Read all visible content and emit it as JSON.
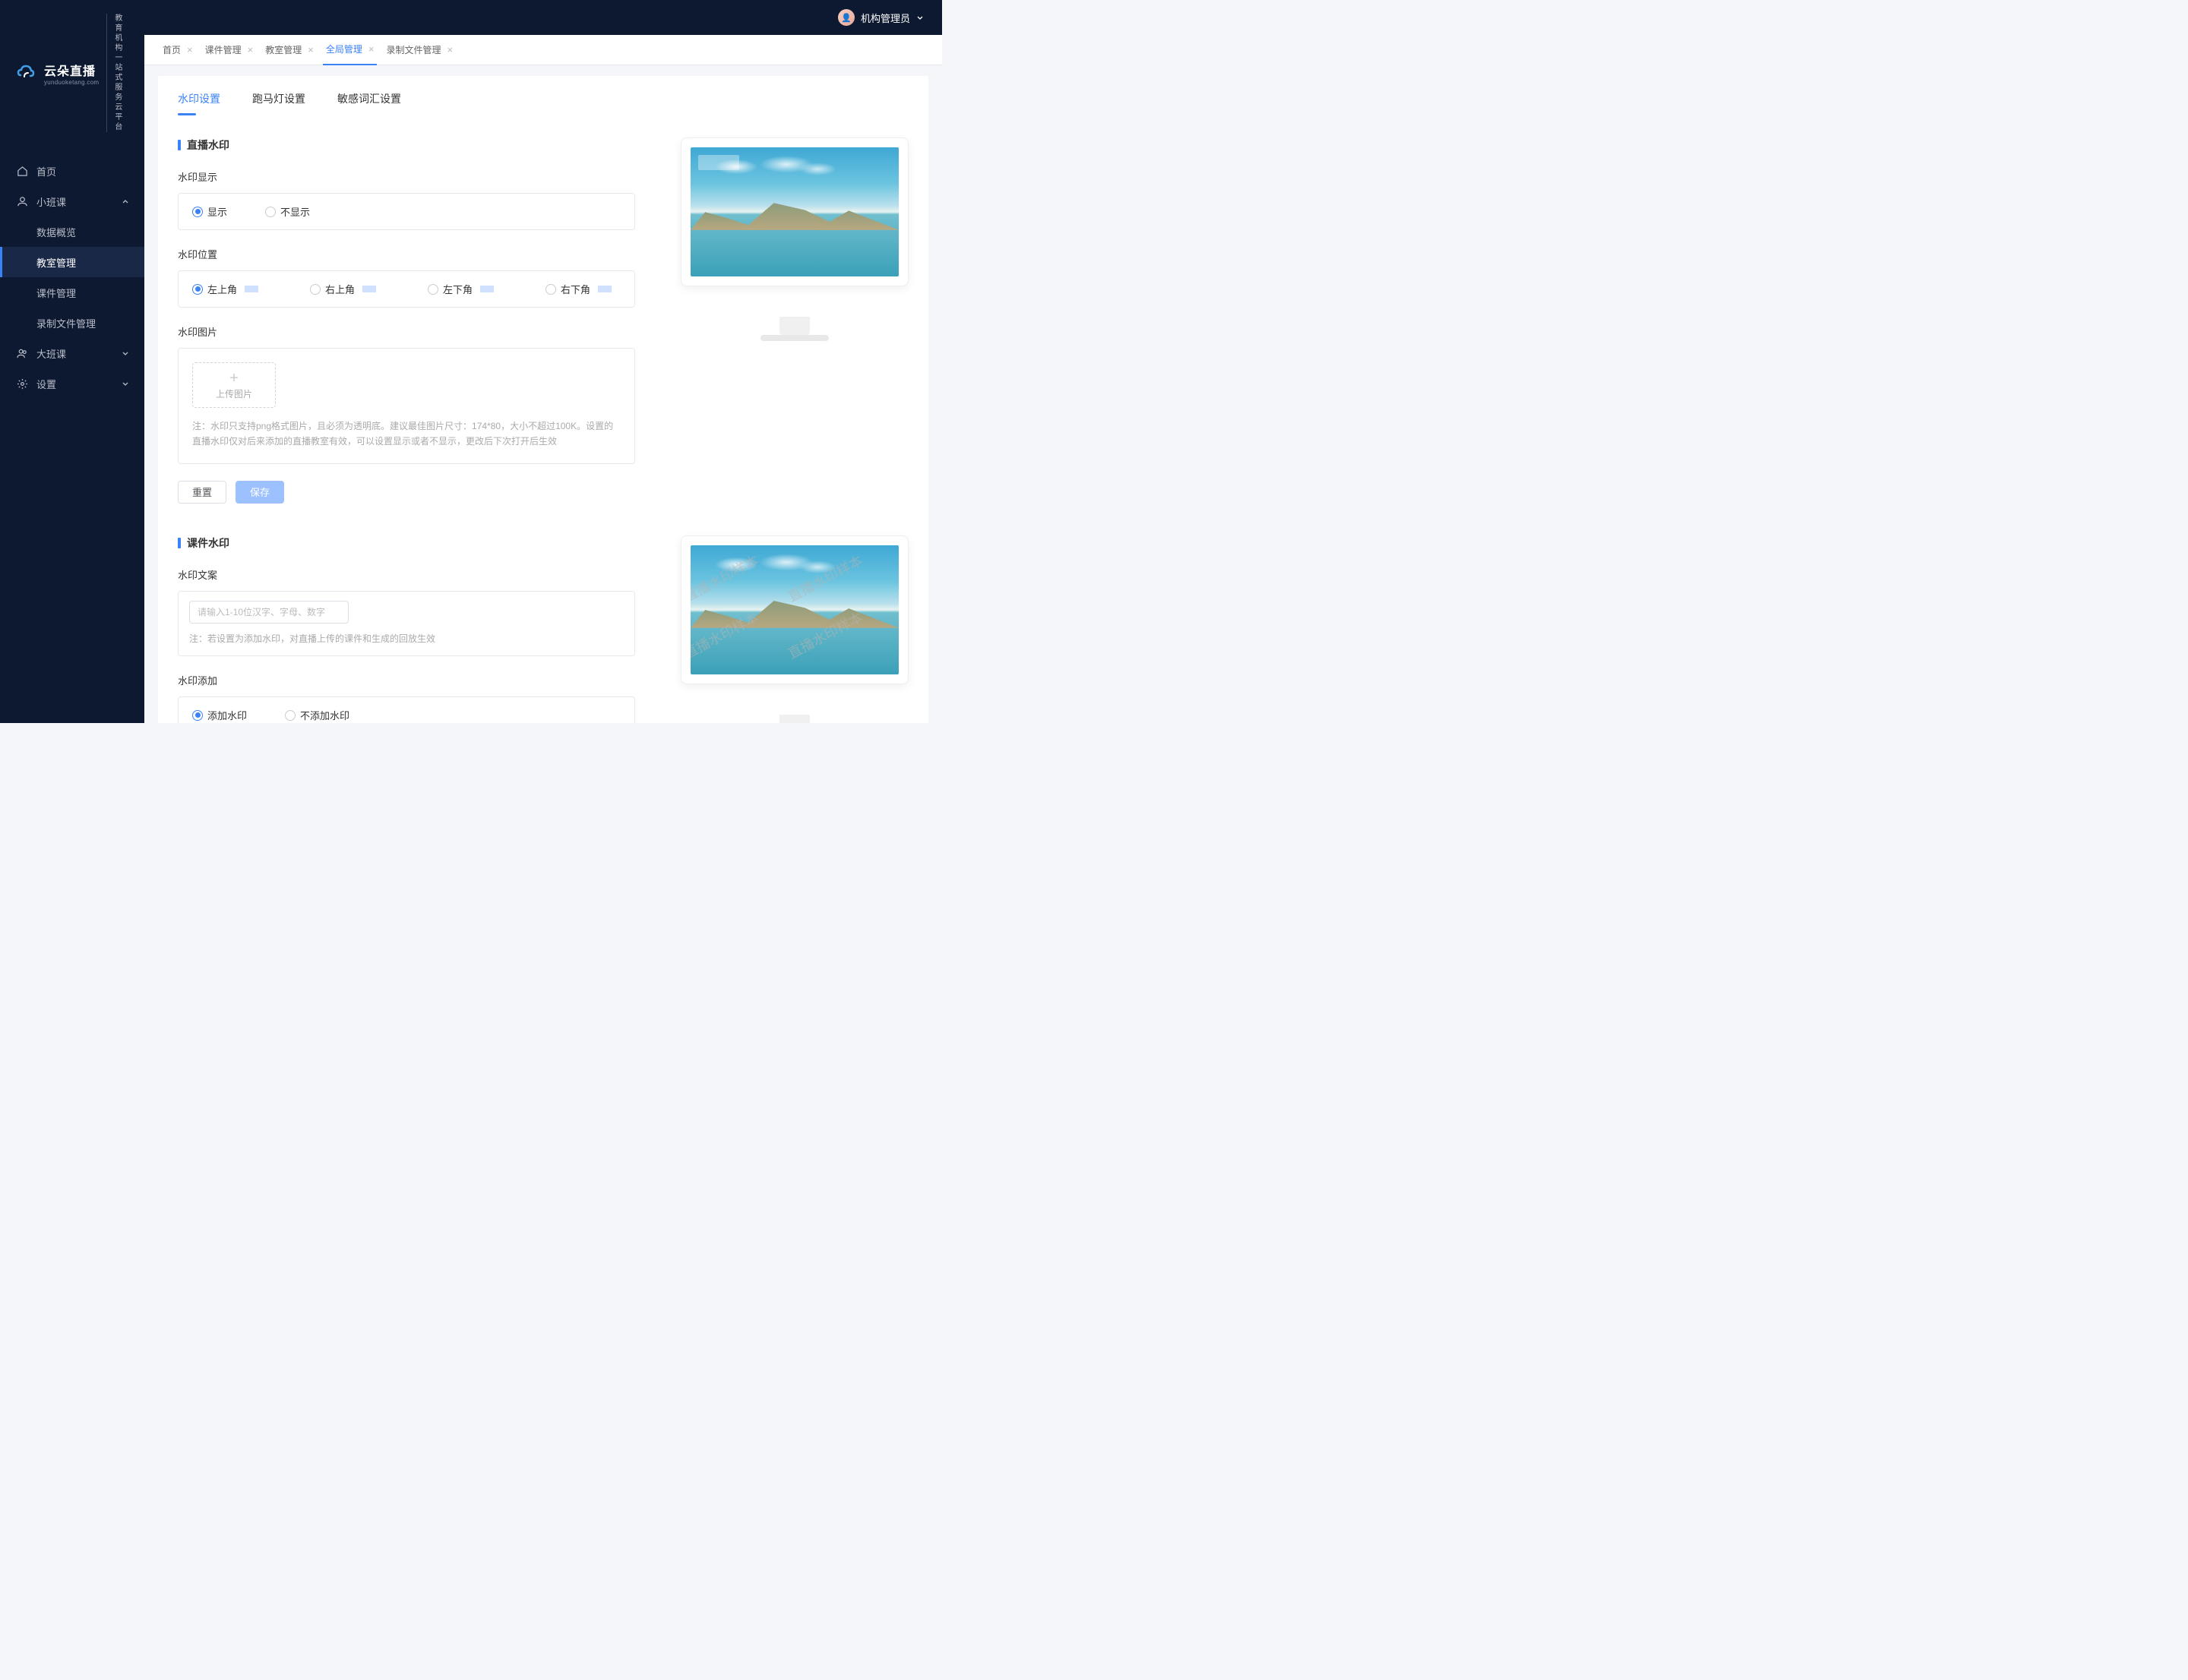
{
  "brand": {
    "main": "云朵直播",
    "sub": "yunduoketang.com",
    "slogan1": "教育机构一站",
    "slogan2": "式服务云平台"
  },
  "topbar": {
    "user": "机构管理员"
  },
  "nav": {
    "home": "首页",
    "small": "小班课",
    "small_sub": {
      "data": "数据概览",
      "room": "教室管理",
      "course": "课件管理",
      "record": "录制文件管理"
    },
    "big": "大班课",
    "settings": "设置"
  },
  "tabs": [
    "首页",
    "课件管理",
    "教室管理",
    "全局管理",
    "录制文件管理"
  ],
  "active_tab_index": 3,
  "inner_tabs": [
    "水印设置",
    "跑马灯设置",
    "敏感词汇设置"
  ],
  "inner_active_index": 0,
  "sect1": {
    "title": "直播水印",
    "display_label": "水印显示",
    "display_opts": [
      "显示",
      "不显示"
    ],
    "pos_label": "水印位置",
    "pos_opts": [
      "左上角",
      "右上角",
      "左下角",
      "右下角"
    ],
    "img_label": "水印图片",
    "upload": "上传图片",
    "note": "注：水印只支持png格式图片，且必须为透明底。建议最佳图片尺寸：174*80，大小不超过100K。设置的直播水印仅对后来添加的直播教室有效，可以设置显示或者不显示，更改后下次打开后生效"
  },
  "sect2": {
    "title": "课件水印",
    "text_label": "水印文案",
    "placeholder": "请输入1-10位汉字、字母、数字",
    "note": "注：若设置为添加水印，对直播上传的课件和生成的回放生效",
    "add_label": "水印添加",
    "add_opts": [
      "添加水印",
      "不添加水印"
    ]
  },
  "btns": {
    "reset": "重置",
    "save": "保存"
  },
  "wm_sample": "直播水印样本"
}
